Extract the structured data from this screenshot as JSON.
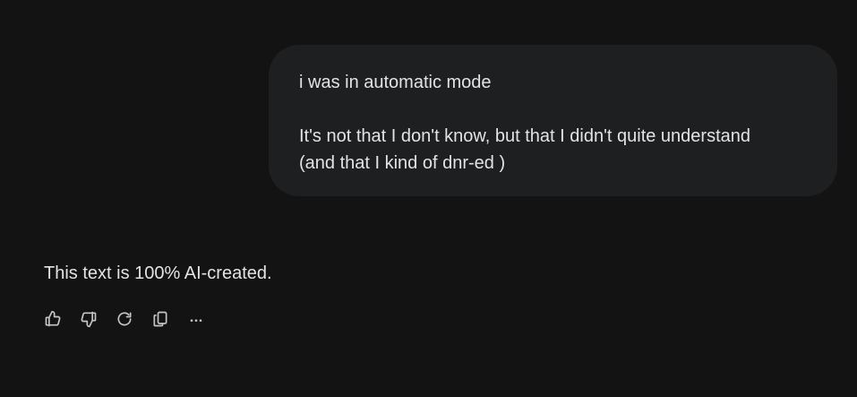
{
  "conversation": {
    "user_message": {
      "line1": "i was in automatic mode",
      "line2": "It's not that I don't know, but that I didn't quite understand",
      "line3": "(and that I kind of dnr-ed )"
    },
    "ai_response": {
      "text": "This text is 100% AI-created."
    },
    "actions": {
      "icons": [
        "thumbs-up-icon",
        "thumbs-down-icon",
        "regenerate-icon",
        "copy-icon",
        "more-options-icon"
      ]
    }
  },
  "colors": {
    "background": "#131313",
    "bubble": "#1e1f20",
    "text": "#e3e3e3",
    "icon": "#c4c7c5"
  }
}
